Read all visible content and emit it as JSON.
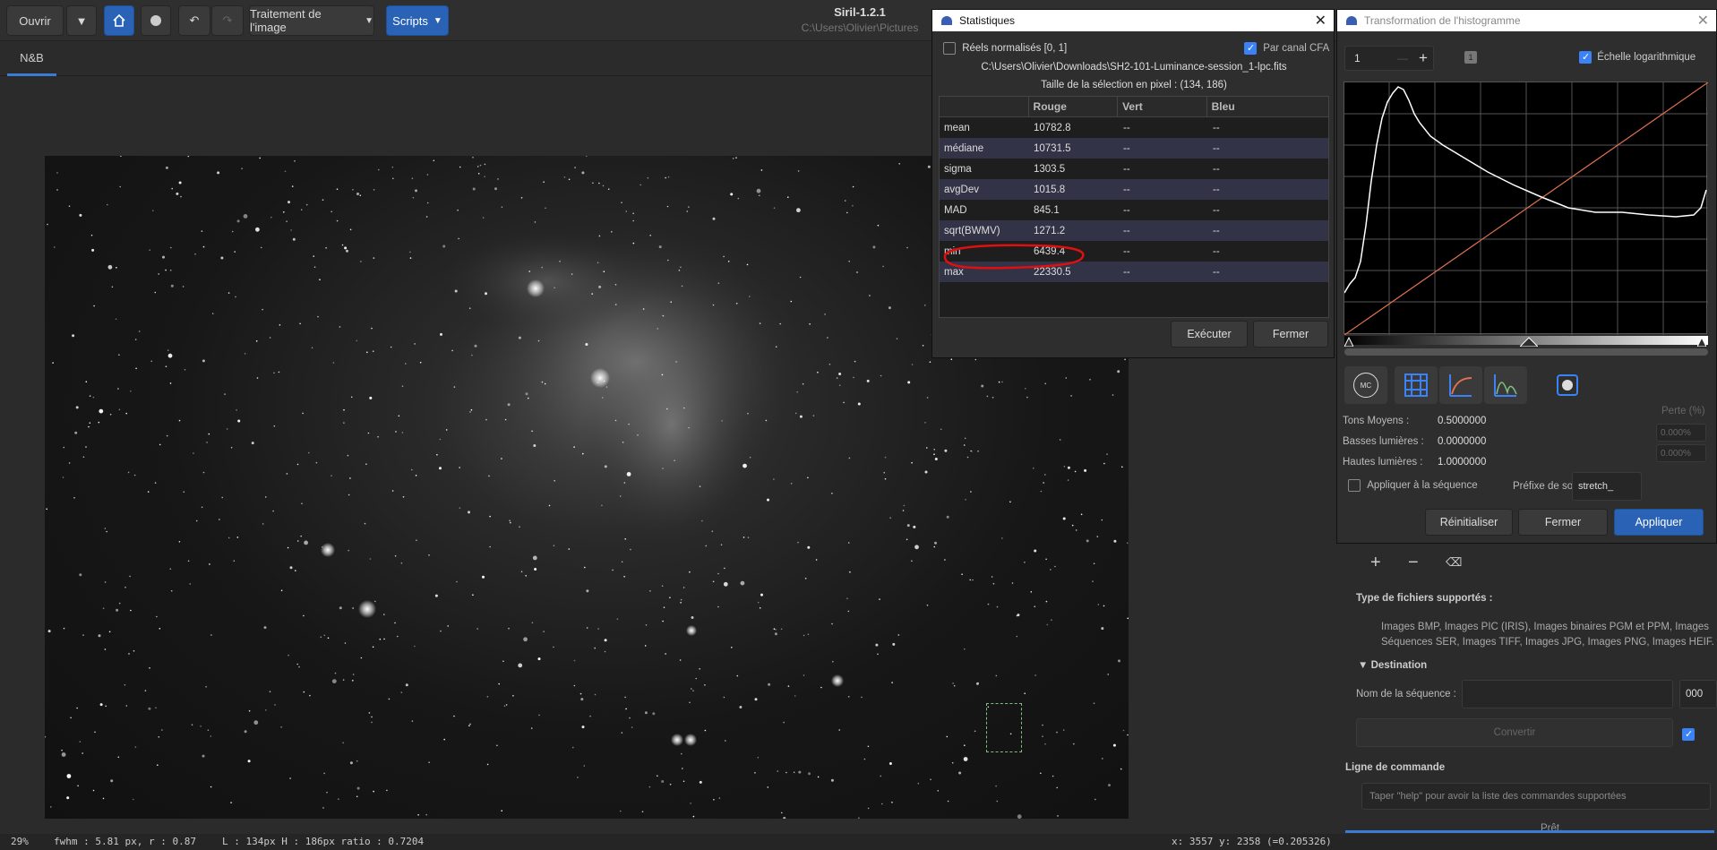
{
  "header": {
    "open_label": "Ouvrir",
    "processing_label": "Traitement de l'image",
    "scripts_label": "Scripts",
    "app_title": "Siril-1.2.1",
    "app_path": "C:\\Users\\Olivier\\Pictures"
  },
  "tabs": {
    "nb": "N&B"
  },
  "status": {
    "zoom": "29%",
    "fwhm": "fwhm : 5.81 px, r : 0.87",
    "selection": "L : 134px H : 186px ratio : 0.7204",
    "coords": "x: 3557 y: 2358 (=0.205326)"
  },
  "stats": {
    "title": "Statistiques",
    "normalized_label": "Réels normalisés [0, 1]",
    "cfa_label": "Par canal CFA",
    "file": "C:\\Users\\Olivier\\Downloads\\SH2-101-Luminance-session_1-lpc.fits",
    "selection_size": "Taille de la sélection en pixel : (134, 186)",
    "columns": [
      "",
      "Rouge",
      "Vert",
      "Bleu"
    ],
    "rows": [
      {
        "name": "mean",
        "r": "10782.8",
        "g": "--",
        "b": "--"
      },
      {
        "name": "médiane",
        "r": "10731.5",
        "g": "--",
        "b": "--"
      },
      {
        "name": "sigma",
        "r": "1303.5",
        "g": "--",
        "b": "--"
      },
      {
        "name": "avgDev",
        "r": "1015.8",
        "g": "--",
        "b": "--"
      },
      {
        "name": "MAD",
        "r": "845.1",
        "g": "--",
        "b": "--"
      },
      {
        "name": "sqrt(BWMV)",
        "r": "1271.2",
        "g": "--",
        "b": "--"
      },
      {
        "name": "min",
        "r": "6439.4",
        "g": "--",
        "b": "--"
      },
      {
        "name": "max",
        "r": "22330.5",
        "g": "--",
        "b": "--"
      }
    ],
    "run_label": "Exécuter",
    "close_label": "Fermer"
  },
  "hist": {
    "title": "Transformation de l'histogramme",
    "zoom_value": "1",
    "log_label": "Échelle logarithmique",
    "mc_label": "MC",
    "midtones_label": "Tons Moyens :",
    "midtones_value": "0.5000000",
    "shadows_label": "Basses lumières :",
    "shadows_value": "0.0000000",
    "highlights_label": "Hautes lumières :",
    "highlights_value": "1.0000000",
    "loss_label": "Perte (%)",
    "loss_shadow": "0.000%",
    "loss_high": "0.000%",
    "apply_seq_label": "Appliquer à la séquence",
    "prefix_label": "Préfixe de sortie :",
    "prefix_value": "stretch_",
    "reset_label": "Réinitialiser",
    "close_label": "Fermer",
    "apply_label": "Appliquer"
  },
  "panel": {
    "file_types_title": "Type de fichiers supportés :",
    "file_types_line1": "Images BMP, Images PIC (IRIS), Images binaires PGM et PPM, Images",
    "file_types_line2": "Séquences SER, Images TIFF, Images JPG, Images PNG, Images HEIF.",
    "destination_label": "Destination",
    "seq_name_label": "Nom de la séquence :",
    "seq_start": "000",
    "convert_label": "Convertir",
    "cmdline_label": "Ligne de commande",
    "cmd_placeholder": "Taper \"help\" pour avoir la liste des commandes supportées",
    "ready": "Prêt."
  },
  "colors": {
    "accent": "#2a63b6",
    "annotation": "#e01010",
    "curve": "#e07050"
  }
}
